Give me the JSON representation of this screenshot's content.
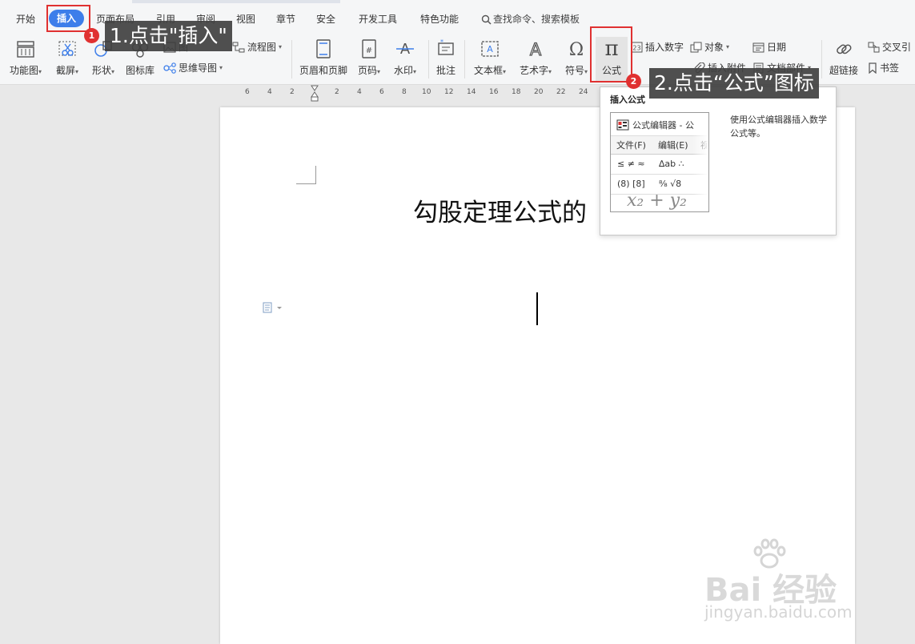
{
  "menu_tabs": [
    "开始",
    "插入",
    "页面布局",
    "引用",
    "审阅",
    "视图",
    "章节",
    "安全",
    "开发工具",
    "特色功能"
  ],
  "search": {
    "label": "查找命令、搜索模板"
  },
  "ribbon": {
    "function_chart": "功能图",
    "screenshot": "截屏",
    "shapes": "形状",
    "icon_lib": "图标库",
    "picture": "图",
    "flowchart": "流程图",
    "mindmap": "思维导图",
    "header_footer": "页眉和页脚",
    "page_number": "页码",
    "watermark": "水印",
    "comment": "批注",
    "textbox": "文本框",
    "wordart": "艺术字",
    "symbol": "符号",
    "formula": "公式",
    "insert_number": "插入数字",
    "object": "对象",
    "date": "日期",
    "insert_attachment": "插入附件",
    "doc_parts": "文档部件",
    "hyperlink": "超链接",
    "cross_ref": "交叉引",
    "bookmark": "书签"
  },
  "ruler": [
    "6",
    "4",
    "2",
    "2",
    "4",
    "6",
    "8",
    "10",
    "12",
    "14",
    "16",
    "18",
    "20",
    "22",
    "24"
  ],
  "document": {
    "title": "勾股定理公式的"
  },
  "tooltip": {
    "title": "插入公式",
    "description": "使用公式编辑器插入数学公式等。",
    "preview_title": "公式编辑器 - 公",
    "preview_menu": [
      "文件(F)",
      "编辑(E)",
      "视"
    ],
    "preview_sym_row1": [
      "≤ ≠ ≈",
      "∆ab ∴"
    ],
    "preview_sym_row2": [
      "(8) [8]",
      "⁸⁄₈ √8"
    ],
    "preview_equation": "x₂ + y₂"
  },
  "annotations": {
    "step1_badge": "1",
    "step1_text": "1.点击\"插入\"",
    "step2_badge": "2",
    "step2_text": "2.点击“公式”图标"
  },
  "watermark": {
    "brand": "Bai 经验",
    "url": "jingyan.baidu.com"
  },
  "colors": {
    "active_tab": "#3d7eea",
    "highlight": "#e03131",
    "callout_bg": "#404040"
  }
}
